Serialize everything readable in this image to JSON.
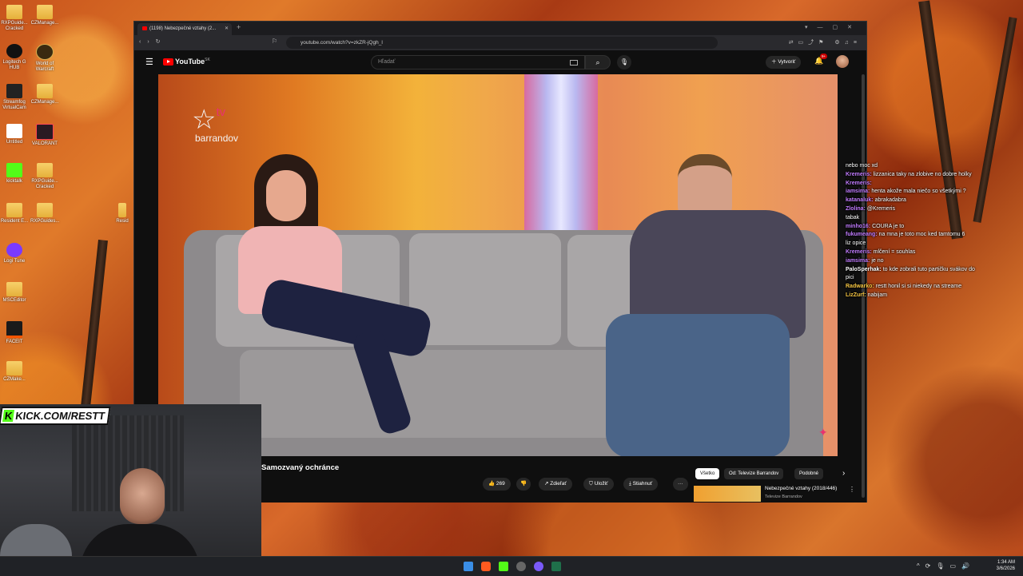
{
  "desktop": {
    "icons": [
      {
        "label": "RXPGuide... Cracked"
      },
      {
        "label": "CZManage..."
      },
      {
        "label": "Logitech G HUB"
      },
      {
        "label": "World of Warcraft"
      },
      {
        "label": "Streamfog VirtualCam"
      },
      {
        "label": "CZManage..."
      },
      {
        "label": "Untitled"
      },
      {
        "label": "VALORANT"
      },
      {
        "label": "kicktalk"
      },
      {
        "label": "RXPGuide... Cracked"
      },
      {
        "label": "Resident E..."
      },
      {
        "label": "RXPGuides..."
      },
      {
        "label": "Logi Tune"
      },
      {
        "label": "MSCEditor"
      },
      {
        "label": "FACEIT"
      },
      {
        "label": "CZMake..."
      },
      {
        "label": "Resid"
      }
    ]
  },
  "browser": {
    "tab_title": "(1198) Nebezpečné vztahy (2...",
    "url": "youtube.com/watch?v=zkZR-jQgh_l"
  },
  "youtube": {
    "logo": "YouTube",
    "region": "SK",
    "search_placeholder": "Hľadať",
    "create_label": "Vytvoriť",
    "notif_count": "9+",
    "video": {
      "channel_logo_tv": "tv",
      "channel_logo_name": "barrandov",
      "title": "Samozvaný ochránce",
      "likes": "269",
      "share": "Zdieľať",
      "save": "Uložiť",
      "download": "Stiahnuť"
    },
    "chips": [
      "Všetko",
      "Od: Televize Barrandov",
      "Podobné"
    ],
    "recommendation": {
      "title": "Nebezpečné vztahy (2018/446)",
      "channel": "Televize Barrandov"
    }
  },
  "stream": {
    "kick_badge": "K",
    "kick_url": "KICK.COM/RESTT",
    "chat": [
      {
        "user": "",
        "text": "nebo moc xd",
        "color": "#ffffff"
      },
      {
        "user": "Kremeris:",
        "text": "lizzanica taky na zlobive no dobre holky",
        "color": "#c17cff"
      },
      {
        "user": "Kremeris:",
        "text": "",
        "color": "#c17cff"
      },
      {
        "user": "iamsima:",
        "text": "henta akože mala niečo so všetkými ?",
        "color": "#c17cff"
      },
      {
        "user": "katanaluk:",
        "text": "abrakadabra",
        "color": "#c17cff"
      },
      {
        "user": "Zlolina:",
        "text": "@Kremeris",
        "color": "#c17cff"
      },
      {
        "user": "",
        "text": "tabak",
        "color": "#ff4d4d"
      },
      {
        "user": "minho16:",
        "text": "COURA je to",
        "color": "#c17cff"
      },
      {
        "user": "fukumeang:",
        "text": "na mna je toto moc ked tamtomu 6",
        "color": "#c17cff"
      },
      {
        "user": "",
        "text": "liz opice",
        "color": "#ff4d4d"
      },
      {
        "user": "Kremeris:",
        "text": "mlčení = souhlas",
        "color": "#c17cff"
      },
      {
        "user": "iamsima:",
        "text": "je no",
        "color": "#c17cff"
      },
      {
        "user": "PaloSperhak:",
        "text": "to kde zobrali tuto partičku svákov do pici",
        "color": "#ffffff"
      },
      {
        "user": "Radwarko:",
        "text": "restt honil si si niekedy na streame",
        "color": "#f5c542"
      },
      {
        "user": "LizZurf:",
        "text": "nabijam",
        "color": "#f5c542"
      }
    ]
  },
  "taskbar": {
    "time": "1:34 AM",
    "date": "3/6/2026"
  }
}
